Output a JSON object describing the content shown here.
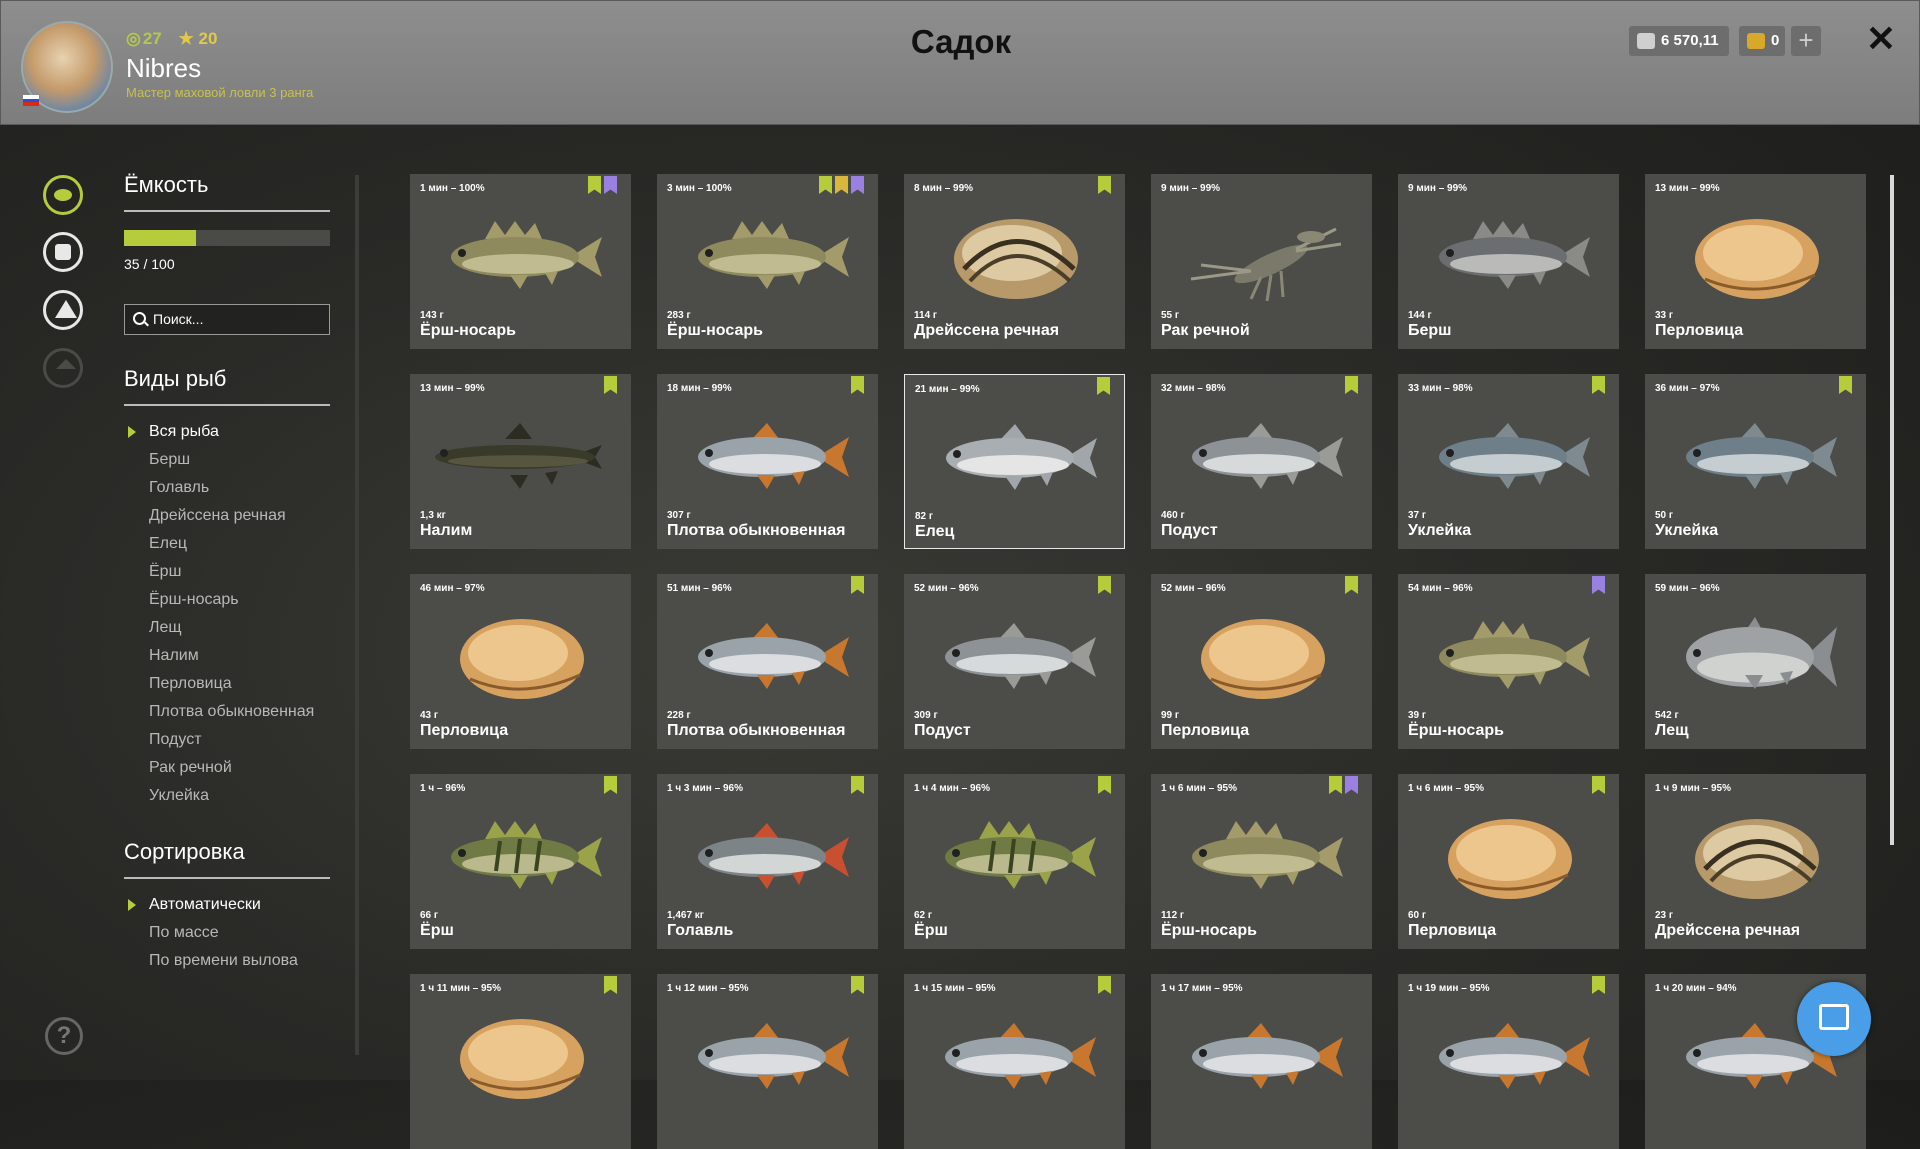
{
  "header": {
    "title": "Садок",
    "player": {
      "level": "27",
      "stars": "20",
      "name": "Nibres",
      "rank": "Мастер маховой ловли 3 ранга"
    },
    "silver": "6 570,11",
    "gold": "0",
    "close_icon": "close-icon"
  },
  "sidebar": {
    "capacity_title": "Ёмкость",
    "capacity_text": "35 / 100",
    "capacity_fraction": 0.35,
    "search_placeholder": "Поиск...",
    "species_title": "Виды рыб",
    "species": [
      "Вся рыба",
      "Берш",
      "Голавль",
      "Дрейссена речная",
      "Елец",
      "Ёрш",
      "Ёрш-носарь",
      "Лещ",
      "Налим",
      "Перловица",
      "Плотва обыкновенная",
      "Подуст",
      "Рак речной",
      "Уклейка"
    ],
    "sort_title": "Сортировка",
    "sort_options": [
      "Автоматически",
      "По массе",
      "По времени вылова"
    ]
  },
  "colors": {
    "accent_green": "#b7cc3a",
    "badge_yellow": "#d8b73a",
    "badge_purple": "#9a80e0",
    "fab_blue": "#4a9ee8"
  },
  "cards": [
    {
      "time": "1 мин – 100%",
      "weight": "143 г",
      "name": "Ёрш-носарь",
      "kind": "ruffe",
      "badges": [
        "g",
        "p"
      ]
    },
    {
      "time": "3 мин – 100%",
      "weight": "283 г",
      "name": "Ёрш-носарь",
      "kind": "ruffe",
      "badges": [
        "g",
        "y",
        "p"
      ]
    },
    {
      "time": "8 мин – 99%",
      "weight": "114 г",
      "name": "Дрейссена речная",
      "kind": "mussel",
      "badges": [
        "g"
      ]
    },
    {
      "time": "9 мин – 99%",
      "weight": "55 г",
      "name": "Рак речной",
      "kind": "crayfish",
      "badges": []
    },
    {
      "time": "9 мин – 99%",
      "weight": "144 г",
      "name": "Берш",
      "kind": "bersh",
      "badges": []
    },
    {
      "time": "13 мин – 99%",
      "weight": "33 г",
      "name": "Перловица",
      "kind": "clam",
      "badges": []
    },
    {
      "time": "13 мин – 99%",
      "weight": "1,3 кг",
      "name": "Налим",
      "kind": "burbot",
      "badges": [
        "g"
      ]
    },
    {
      "time": "18 мин – 99%",
      "weight": "307 г",
      "name": "Плотва обыкновенная",
      "kind": "roach",
      "badges": [
        "g"
      ]
    },
    {
      "time": "21 мин – 99%",
      "weight": "82 г",
      "name": "Елец",
      "kind": "dace",
      "badges": [
        "g"
      ],
      "selected": true
    },
    {
      "time": "32 мин – 98%",
      "weight": "460 г",
      "name": "Подуст",
      "kind": "nase",
      "badges": [
        "g"
      ]
    },
    {
      "time": "33 мин – 98%",
      "weight": "37 г",
      "name": "Уклейка",
      "kind": "bleak",
      "badges": [
        "g"
      ]
    },
    {
      "time": "36 мин – 97%",
      "weight": "50 г",
      "name": "Уклейка",
      "kind": "bleak",
      "badges": [
        "g"
      ]
    },
    {
      "time": "46 мин – 97%",
      "weight": "43 г",
      "name": "Перловица",
      "kind": "clam",
      "badges": []
    },
    {
      "time": "51 мин – 96%",
      "weight": "228 г",
      "name": "Плотва обыкновенная",
      "kind": "roach",
      "badges": [
        "g"
      ]
    },
    {
      "time": "52 мин – 96%",
      "weight": "309 г",
      "name": "Подуст",
      "kind": "nase",
      "badges": [
        "g"
      ]
    },
    {
      "time": "52 мин – 96%",
      "weight": "99 г",
      "name": "Перловица",
      "kind": "clam",
      "badges": [
        "g"
      ]
    },
    {
      "time": "54 мин – 96%",
      "weight": "39 г",
      "name": "Ёрш-носарь",
      "kind": "ruffe",
      "badges": [
        "p"
      ]
    },
    {
      "time": "59 мин – 96%",
      "weight": "542 г",
      "name": "Лещ",
      "kind": "bream",
      "badges": []
    },
    {
      "time": "1 ч – 96%",
      "weight": "66 г",
      "name": "Ёрш",
      "kind": "perch",
      "badges": [
        "g"
      ]
    },
    {
      "time": "1 ч 3 мин – 96%",
      "weight": "1,467 кг",
      "name": "Голавль",
      "kind": "chub",
      "badges": [
        "g"
      ]
    },
    {
      "time": "1 ч 4 мин – 96%",
      "weight": "62 г",
      "name": "Ёрш",
      "kind": "perch",
      "badges": [
        "g"
      ]
    },
    {
      "time": "1 ч 6 мин – 95%",
      "weight": "112 г",
      "name": "Ёрш-носарь",
      "kind": "ruffe",
      "badges": [
        "g",
        "p"
      ]
    },
    {
      "time": "1 ч 6 мин – 95%",
      "weight": "60 г",
      "name": "Перловица",
      "kind": "clam",
      "badges": [
        "g"
      ]
    },
    {
      "time": "1 ч 9 мин – 95%",
      "weight": "23 г",
      "name": "Дрейссена речная",
      "kind": "mussel",
      "badges": []
    },
    {
      "time": "1 ч 11 мин – 95%",
      "weight": "",
      "name": "",
      "kind": "clam",
      "badges": [
        "g"
      ]
    },
    {
      "time": "1 ч 12 мин – 95%",
      "weight": "",
      "name": "",
      "kind": "roach",
      "badges": [
        "g"
      ]
    },
    {
      "time": "1 ч 15 мин – 95%",
      "weight": "",
      "name": "",
      "kind": "roach",
      "badges": [
        "g"
      ]
    },
    {
      "time": "1 ч 17 мин – 95%",
      "weight": "",
      "name": "",
      "kind": "roach",
      "badges": []
    },
    {
      "time": "1 ч 19 мин – 95%",
      "weight": "",
      "name": "",
      "kind": "roach",
      "badges": [
        "g"
      ]
    },
    {
      "time": "1 ч 20 мин – 94%",
      "weight": "",
      "name": "",
      "kind": "roach",
      "badges": []
    }
  ]
}
